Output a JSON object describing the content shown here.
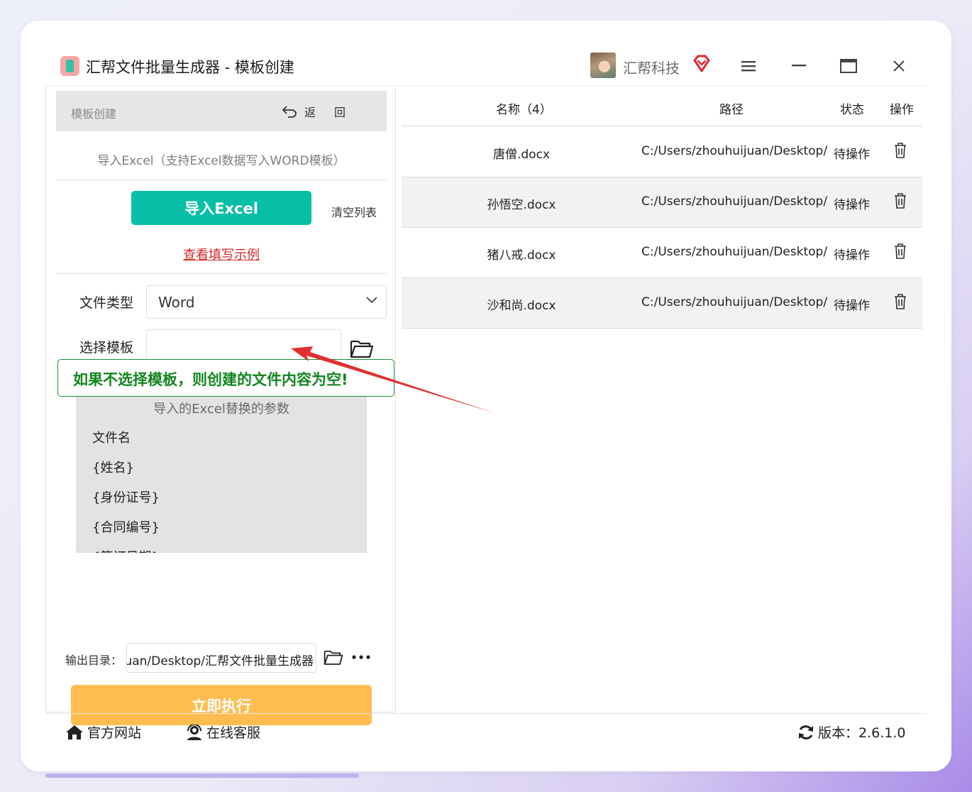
{
  "window": {
    "title": "汇帮文件批量生成器 - 模板创建",
    "brand": "汇帮科技"
  },
  "left_panel": {
    "header_label": "模板创建",
    "back_label": "返",
    "back_label2": "回",
    "import_description": "导入Excel（支持Excel数据写入WORD模板）",
    "import_button": "导入Excel",
    "clear_list": "清空列表",
    "example_link": "查看填写示例",
    "file_type_label": "文件类型",
    "file_type_value": "Word",
    "template_label": "选择模板",
    "template_value": "",
    "callout_text": "如果不选择模板，则创建的文件内容为空!",
    "params_title": "导入的Excel替换的参数",
    "params": [
      "文件名",
      "{姓名}",
      "{身份证号}",
      "{合同编号}",
      "{签订日期}"
    ],
    "output_label": "输出目录：",
    "output_value": "uan/Desktop/汇帮文件批量生成器",
    "run_button": "立即执行"
  },
  "table": {
    "headers": {
      "name": "名称（4）",
      "path": "路径",
      "status": "状态",
      "action": "操作"
    },
    "rows": [
      {
        "name": "唐僧.docx",
        "path": "C:/Users/zhouhuijuan/Desktop/",
        "status": "待操作"
      },
      {
        "name": "孙悟空.docx",
        "path": "C:/Users/zhouhuijuan/Desktop/",
        "status": "待操作"
      },
      {
        "name": "猪八戒.docx",
        "path": "C:/Users/zhouhuijuan/Desktop/",
        "status": "待操作"
      },
      {
        "name": "沙和尚.docx",
        "path": "C:/Users/zhouhuijuan/Desktop/",
        "status": "待操作"
      }
    ]
  },
  "footer": {
    "website": "官方网站",
    "support": "在线客服",
    "version": "版本：2.6.1.0"
  },
  "colors": {
    "import_button": "#06bfa6",
    "run_button": "#ffbd4f",
    "link": "#d22a2a",
    "callout": "#12861f",
    "arrow": "#e03030"
  }
}
